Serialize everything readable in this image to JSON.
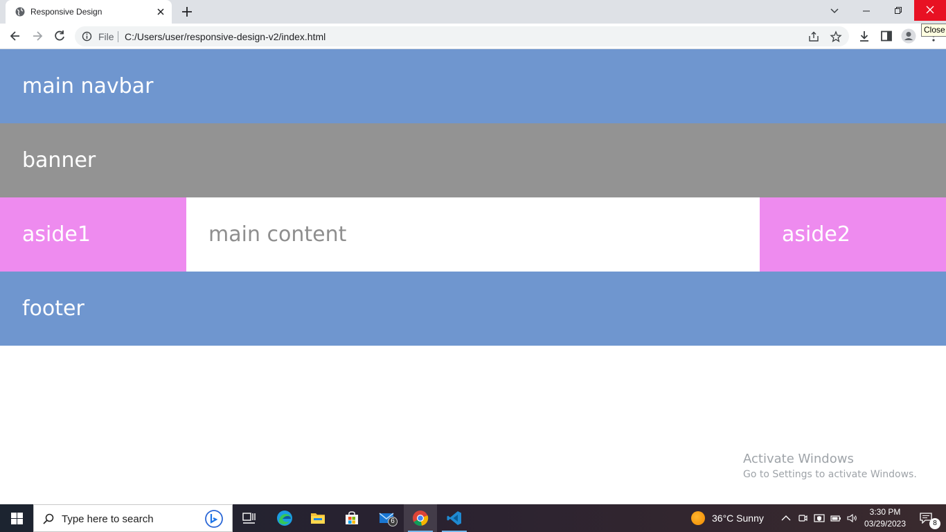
{
  "browser": {
    "tab_title": "Responsive Design",
    "omnibox_scheme": "File",
    "url": "C:/Users/user/responsive-design-v2/index.html",
    "tooltip": "Close"
  },
  "page": {
    "navbar": "main navbar",
    "banner": "banner",
    "aside1": "aside1",
    "main_content": "main content",
    "aside2": "aside2",
    "footer": "footer",
    "colors": {
      "navbar": "#6f96cf",
      "banner": "#939393",
      "aside": "#ee8bef",
      "footer": "#6f96cf"
    }
  },
  "watermark": {
    "title": "Activate Windows",
    "subtitle": "Go to Settings to activate Windows."
  },
  "taskbar": {
    "search_placeholder": "Type here to search",
    "mail_badge": "6",
    "weather": "36°C  Sunny",
    "time": "3:30 PM",
    "date": "03/29/2023",
    "notification_count": "8",
    "apps": [
      "task-view",
      "edge",
      "file-explorer",
      "microsoft-store",
      "mail",
      "chrome",
      "vscode"
    ]
  }
}
